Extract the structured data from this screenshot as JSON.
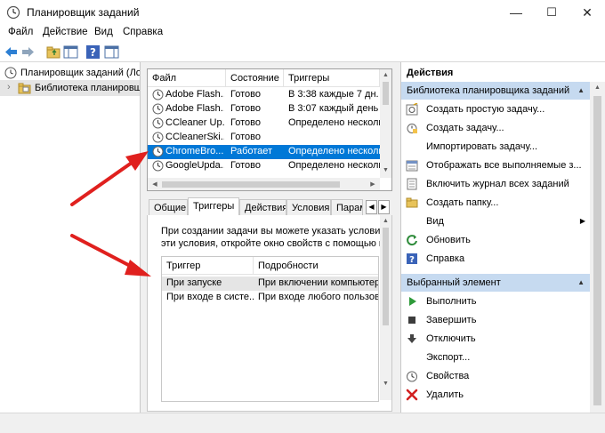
{
  "window": {
    "title": "Планировщик заданий",
    "minimize_glyph": "—",
    "maximize_glyph": "☐",
    "close_glyph": "✕"
  },
  "menu": [
    "Файл",
    "Действие",
    "Вид",
    "Справка"
  ],
  "toolbar": {
    "icons": [
      "back-arrow-icon",
      "forward-arrow-icon",
      "folder-up-icon",
      "console-tree-icon",
      "help-icon",
      "show-pane-icon"
    ]
  },
  "tree": {
    "root": "Планировщик заданий (Лок",
    "child": "Библиотека планировщ",
    "expander": "›"
  },
  "tasks": {
    "columns": [
      "Файл",
      "Состояние",
      "Триггеры"
    ],
    "rows": [
      {
        "name": "Adobe Flash...",
        "status": "Готово",
        "trigger": "В 3:38 каждые 7 дн. - "
      },
      {
        "name": "Adobe Flash...",
        "status": "Готово",
        "trigger": "В 3:07 каждый день - "
      },
      {
        "name": "CCleaner Up...",
        "status": "Готово",
        "trigger": "Определено несколь"
      },
      {
        "name": "CCleanerSki...",
        "status": "Готово",
        "trigger": ""
      },
      {
        "name": "ChromeBro...",
        "status": "Работает",
        "trigger": "Определено несколь"
      },
      {
        "name": "GoogleUpda...",
        "status": "Готово",
        "trigger": "Определено несколь"
      }
    ]
  },
  "tabs": [
    "Общие",
    "Триггеры",
    "Действия",
    "Условия",
    "Парам"
  ],
  "tab_nav": {
    "prev": "◀",
    "next": "▶"
  },
  "details": {
    "line1": "При создании задачи вы можете указать условия, п",
    "line2": "эти условия, откройте окно свойств с помощью ко",
    "columns": [
      "Триггер",
      "Подробности"
    ],
    "rows": [
      {
        "trigger": "При запуске",
        "detail": "При включении компьютер"
      },
      {
        "trigger": "При входе в систе...",
        "detail": "При входе любого пользова"
      }
    ]
  },
  "actions": {
    "title": "Действия",
    "section1": "Библиотека планировщика заданий",
    "section1_items": [
      {
        "label": "Создать простую задачу...",
        "icon": "wand-task-icon"
      },
      {
        "label": "Создать задачу...",
        "icon": "new-task-icon"
      },
      {
        "label": "Импортировать задачу...",
        "icon": ""
      },
      {
        "label": "Отображать все выполняемые з...",
        "icon": "running-tasks-icon"
      },
      {
        "label": "Включить журнал всех заданий",
        "icon": "journal-icon"
      },
      {
        "label": "Создать папку...",
        "icon": "folder-icon"
      },
      {
        "label": "Вид",
        "icon": "",
        "submenu": "▶"
      },
      {
        "label": "Обновить",
        "icon": "refresh-icon"
      },
      {
        "label": "Справка",
        "icon": "help-icon"
      }
    ],
    "section2": "Выбранный элемент",
    "section2_items": [
      {
        "label": "Выполнить",
        "icon": "run-icon"
      },
      {
        "label": "Завершить",
        "icon": "stop-icon"
      },
      {
        "label": "Отключить",
        "icon": "disable-icon"
      },
      {
        "label": "Экспорт...",
        "icon": ""
      },
      {
        "label": "Свойства",
        "icon": "properties-icon"
      },
      {
        "label": "Удалить",
        "icon": "delete-icon"
      }
    ],
    "collapse_glyph": "▲"
  },
  "colors": {
    "selection": "#0078d7",
    "section_header": "#c6daf0",
    "arrow_red": "#e0201e"
  }
}
